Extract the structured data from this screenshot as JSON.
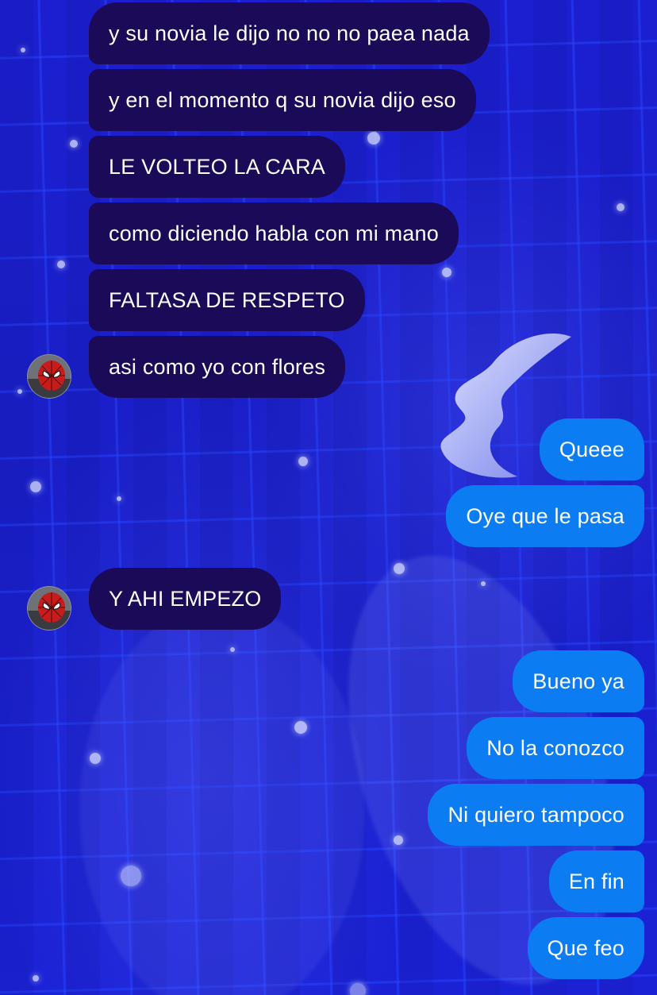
{
  "theme": {
    "incoming_bubble_color": "#1a0a57",
    "outgoing_bubble_color": "#0b7cf2",
    "text_color": "#ffffff",
    "background_color": "#1a1fc4"
  },
  "contact": {
    "avatar_icon": "spiderman-avatar-icon"
  },
  "messages": [
    {
      "direction": "in",
      "text": "y su novia le dijo no no no paea nada"
    },
    {
      "direction": "in",
      "text": "y en el momento q su novia dijo eso"
    },
    {
      "direction": "in",
      "text": "LE VOLTEO LA CARA"
    },
    {
      "direction": "in",
      "text": "como diciendo habla con mi mano"
    },
    {
      "direction": "in",
      "text": "FALTASA DE RESPETO"
    },
    {
      "direction": "in",
      "text": "asi como yo con flores"
    },
    {
      "direction": "out",
      "text": "Queee"
    },
    {
      "direction": "out",
      "text": "Oye que le pasa"
    },
    {
      "direction": "in",
      "text": "Y AHI EMPEZO"
    },
    {
      "direction": "out",
      "text": "Bueno ya"
    },
    {
      "direction": "out",
      "text": "No la conozco"
    },
    {
      "direction": "out",
      "text": "Ni quiero tampoco"
    },
    {
      "direction": "out",
      "text": "En fin"
    },
    {
      "direction": "out",
      "text": "Que feo"
    }
  ]
}
